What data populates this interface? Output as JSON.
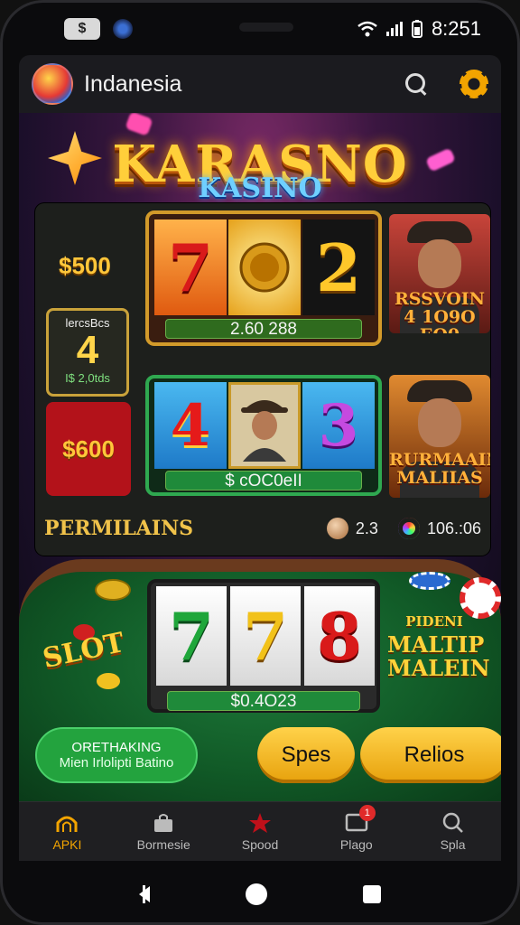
{
  "status_bar": {
    "app_badge": "$",
    "time": "8:251"
  },
  "app_bar": {
    "title": "Indanesia"
  },
  "hero": {
    "title": "KARASNO",
    "subtitle": "KASINO"
  },
  "board": {
    "left_top_amount": "$500",
    "tile": {
      "top_text": "lercsBcs",
      "number": "4",
      "bottom_text": "I$ 2,0tds"
    },
    "left_bottom_amount": "$600",
    "reel_a": {
      "symbols": [
        "7",
        "",
        "2"
      ],
      "value": "2.60 288"
    },
    "reel_b": {
      "symbols": [
        "4",
        "",
        "3"
      ],
      "value": "$ cOC0eII"
    },
    "portrait_1_caption": [
      "RSSVOIN",
      "4 1O9O EO0"
    ],
    "portrait_2_caption": [
      "RURMAAIN",
      "MALIIAS"
    ],
    "section_title": "PERMILAINS",
    "stat_1": "2.3",
    "stat_2": "106.:06"
  },
  "table": {
    "slot_label": "SLOT",
    "reel_c": {
      "symbols": [
        "7",
        "7",
        "8"
      ],
      "value": "$0.4O23"
    },
    "side_caption": [
      "PIDENI",
      "MALTIP",
      "MALEIN"
    ]
  },
  "cta": {
    "green_line1": "ORETHAKING",
    "green_line2": "Mien Irlolipti Batino",
    "gold_1": "Spes",
    "gold_2": "Relios"
  },
  "bottom_nav": {
    "items": [
      {
        "label": "APKI",
        "icon": "wifi-arch-icon",
        "active": true
      },
      {
        "label": "Bormesie",
        "icon": "bag-icon",
        "active": false
      },
      {
        "label": "Spood",
        "icon": "star-icon",
        "active": false
      },
      {
        "label": "Plago",
        "icon": "message-icon",
        "active": false,
        "badge": "1"
      },
      {
        "label": "Spla",
        "icon": "search-icon",
        "active": false
      }
    ]
  },
  "colors": {
    "accent": "#f2a400",
    "green": "#23a33e",
    "gold": "#ffd24a"
  }
}
